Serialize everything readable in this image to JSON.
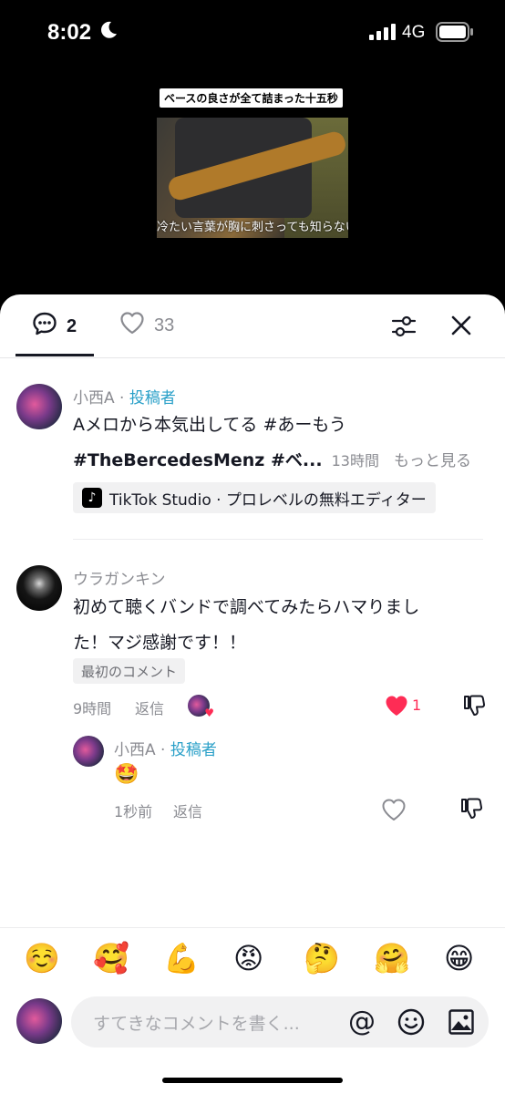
{
  "status": {
    "time": "8:02",
    "network": "4G"
  },
  "video": {
    "title_overlay": "ベースの良さが全て詰まった十五秒",
    "subtitle": "冷たい言葉が胸に刺さっても知らない"
  },
  "tabs": {
    "comments_count": "2",
    "likes_count": "33"
  },
  "caption": {
    "author": "小西A",
    "author_tag": "投稿者",
    "line1": "Aメロから本気出してる #あーもう",
    "line2": "#TheBercedesMenz #ベ...",
    "time": "13時間",
    "more": "もっと見る",
    "studio_label": "TikTok Studio · プロレベルの無料エディター"
  },
  "comments": [
    {
      "author": "ウラガンキン",
      "line1": "初めて聴くバンドで調べてみたらハマりまし",
      "line2": "た！マジ感謝です！！",
      "badge": "最初のコメント",
      "time": "9時間",
      "reply_label": "返信",
      "like_count": "1",
      "liked": true
    }
  ],
  "reply": {
    "author": "小西A",
    "author_tag": "投稿者",
    "text": "🤩",
    "time": "1秒前",
    "reply_label": "返信"
  },
  "emoji_bar": [
    "☺️",
    "🥰",
    "💪",
    "😡",
    "🤔",
    "🤗",
    "😁"
  ],
  "input": {
    "placeholder": "すてきなコメントを書く..."
  },
  "colors": {
    "accent": "#fe2c55",
    "author_tag": "#2aa0c8"
  }
}
